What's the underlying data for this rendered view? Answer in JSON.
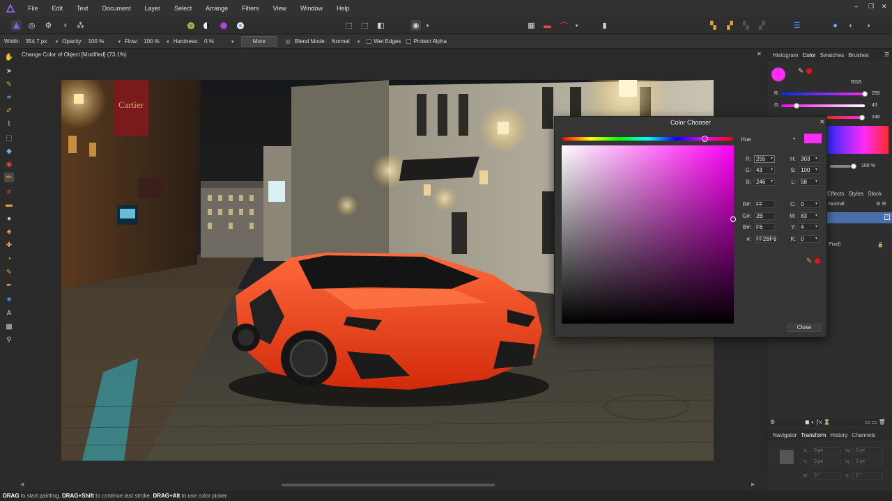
{
  "app": {
    "name": "Affinity Photo"
  },
  "menu": [
    "File",
    "Edit",
    "Text",
    "Document",
    "Layer",
    "Select",
    "Arrange",
    "Filters",
    "View",
    "Window",
    "Help"
  ],
  "context_bar": {
    "width_label": "Width:",
    "width_value": "354.7 px",
    "opacity_label": "Opacity:",
    "opacity_value": "100 %",
    "flow_label": "Flow:",
    "flow_value": "100 %",
    "hardness_label": "Hardness:",
    "hardness_value": "0 %",
    "more_label": "More",
    "blend_label": "Blend Mode:",
    "blend_value": "Normal",
    "wet_edges_label": "Wet Edges",
    "protect_alpha_label": "Protect Alpha"
  },
  "document": {
    "title": "Change Color of Object [Modified] (73.1%)"
  },
  "status": {
    "drag1": "DRAG",
    "t1": " to start painting. ",
    "drag2": "DRAG+Shift",
    "t2": " to continue last stroke. ",
    "drag3": "DRAG+Alt",
    "t3": " to use color picker."
  },
  "right_panel": {
    "top_tabs": [
      "Histogram",
      "Color",
      "Swatches",
      "Brushes"
    ],
    "mode": "RGB",
    "r_label": "R:",
    "r_value": "255",
    "g_label": "G:",
    "g_value": "43",
    "b_value": "246",
    "opacity_value": "100 %",
    "layer_tabs": [
      "Effects",
      "Styles",
      "Stock"
    ],
    "layer_blend": "Normal",
    "layer_name": "Pixel)",
    "bottom_tabs": [
      "Navigator",
      "Transform",
      "History",
      "Channels"
    ],
    "transform": {
      "x_label": "X:",
      "x": "0 px",
      "y_label": "Y:",
      "y": "0 px",
      "w_label": "W:",
      "w": "0 px",
      "h_label": "H:",
      "h": "0 px",
      "r_label": "R:",
      "r": "0 °",
      "s_label": "S:",
      "s": "0 °"
    }
  },
  "color_chooser": {
    "title": "Color Chooser",
    "mode": "Hue",
    "current_color": "#FF2BF6",
    "fields": {
      "r_label": "R:",
      "r": "255",
      "g_label": "G:",
      "g": "43",
      "b_label": "B:",
      "b": "246",
      "h_label": "H:",
      "h": "303",
      "s_label": "S:",
      "s": "100",
      "l_label": "L:",
      "l": "58",
      "rhex_label": "R#:",
      "rhex": "FF",
      "ghex_label": "G#:",
      "ghex": "2B",
      "bhex_label": "B#:",
      "bhex": "F6",
      "hex_label": "#:",
      "hex": "FF2BF6",
      "c_label": "C:",
      "c": "0",
      "m_label": "M:",
      "m": "83",
      "y_label": "Y:",
      "y": "4",
      "k_label": "K:",
      "k": "0"
    },
    "close_label": "Close"
  },
  "photo_text": {
    "shop_sign": "Cartier"
  }
}
